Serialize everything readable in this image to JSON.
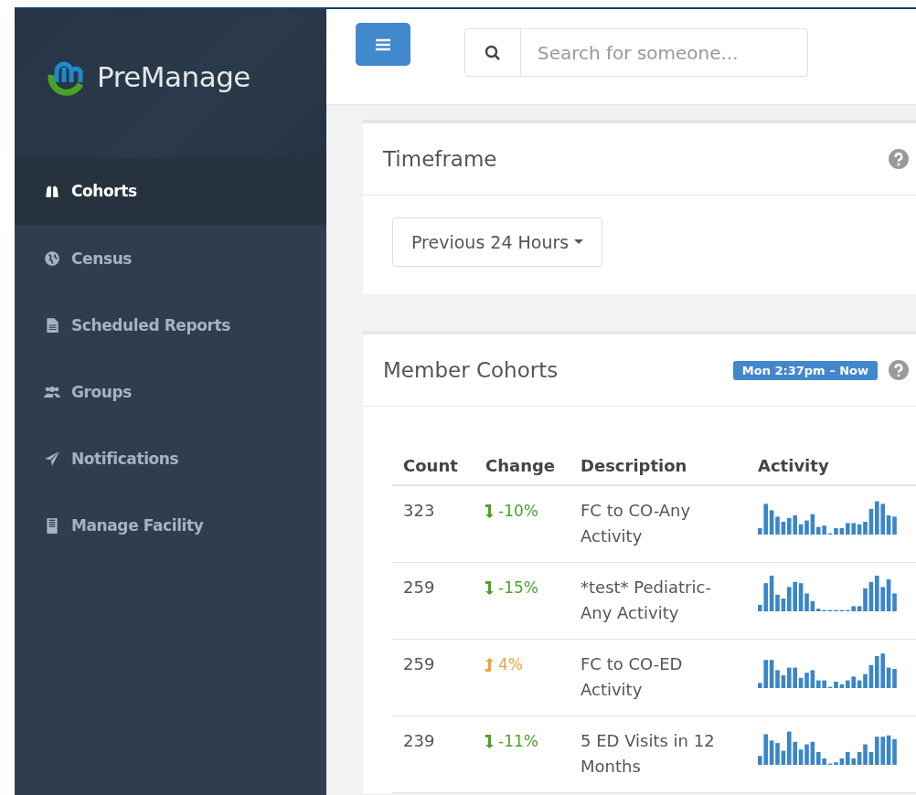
{
  "brand": {
    "name": "PreManage"
  },
  "sidebar": {
    "items": [
      {
        "label": "Cohorts",
        "selected": true
      },
      {
        "label": "Census",
        "selected": false
      },
      {
        "label": "Scheduled Reports",
        "selected": false
      },
      {
        "label": "Groups",
        "selected": false
      },
      {
        "label": "Notifications",
        "selected": false
      },
      {
        "label": "Manage Facility",
        "selected": false
      }
    ]
  },
  "search": {
    "placeholder": "Search for someone..."
  },
  "timeframe": {
    "title": "Timeframe",
    "dropdown": "Previous 24 Hours"
  },
  "member_cohorts": {
    "title": "Member Cohorts",
    "range_badge": "Mon 2:37pm – Now",
    "columns": [
      "Count",
      "Change",
      "Description",
      "Activity"
    ],
    "rows": [
      {
        "count": "323",
        "change": "-10%",
        "kind": "down",
        "description": "FC to CO-Any Activity"
      },
      {
        "count": "259",
        "change": "-15%",
        "kind": "down",
        "description": "*test* Pediatric-Any Activity"
      },
      {
        "count": "259",
        "change": "4%",
        "kind": "up",
        "description": "FC to CO-ED Activity"
      },
      {
        "count": "239",
        "change": "-11%",
        "kind": "down",
        "description": "5 ED Visits in 12 Months"
      }
    ]
  }
}
